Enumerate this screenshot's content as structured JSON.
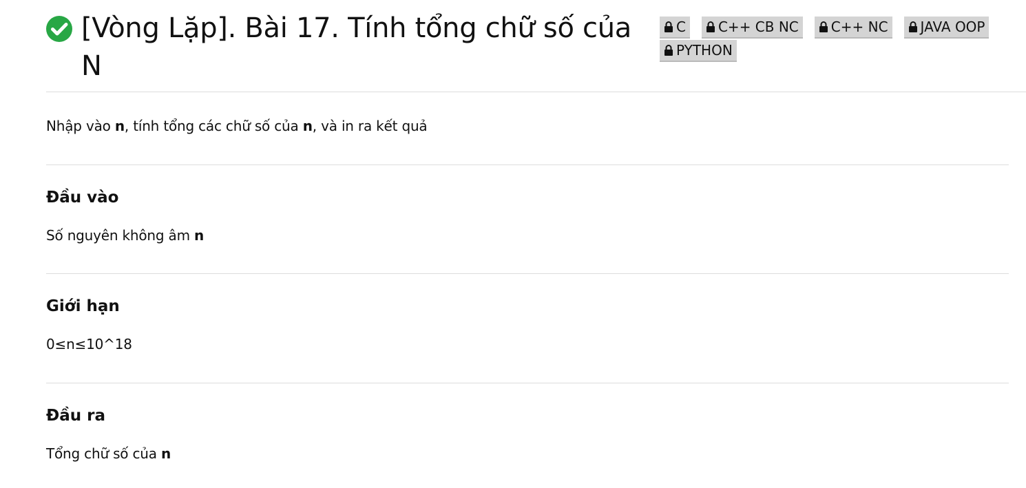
{
  "problem": {
    "title": "[Vòng Lặp]. Bài 17. Tính tổng chữ số của N",
    "status_color": "#28a745",
    "status_icon": "check-circle-icon",
    "tags": [
      {
        "icon": "lock-icon",
        "label": "C"
      },
      {
        "icon": "lock-icon",
        "label": "C++ CB NC"
      },
      {
        "icon": "lock-icon",
        "label": "C++ NC"
      },
      {
        "icon": "lock-icon",
        "label": "JAVA OOP"
      },
      {
        "icon": "lock-icon",
        "label": "PYTHON"
      }
    ]
  },
  "description": {
    "part1": "Nhập vào ",
    "var1": "n",
    "part2": ", tính tổng các chữ số của ",
    "var2": "n",
    "part3": ", và in ra kết quả"
  },
  "sections": {
    "input": {
      "heading": "Đầu vào",
      "text": "Số nguyên không âm ",
      "var": "n"
    },
    "limits": {
      "heading": "Giới hạn",
      "text": "0≤n≤10^18"
    },
    "output": {
      "heading": "Đầu ra",
      "text": "Tổng chữ số của ",
      "var": "n"
    }
  }
}
